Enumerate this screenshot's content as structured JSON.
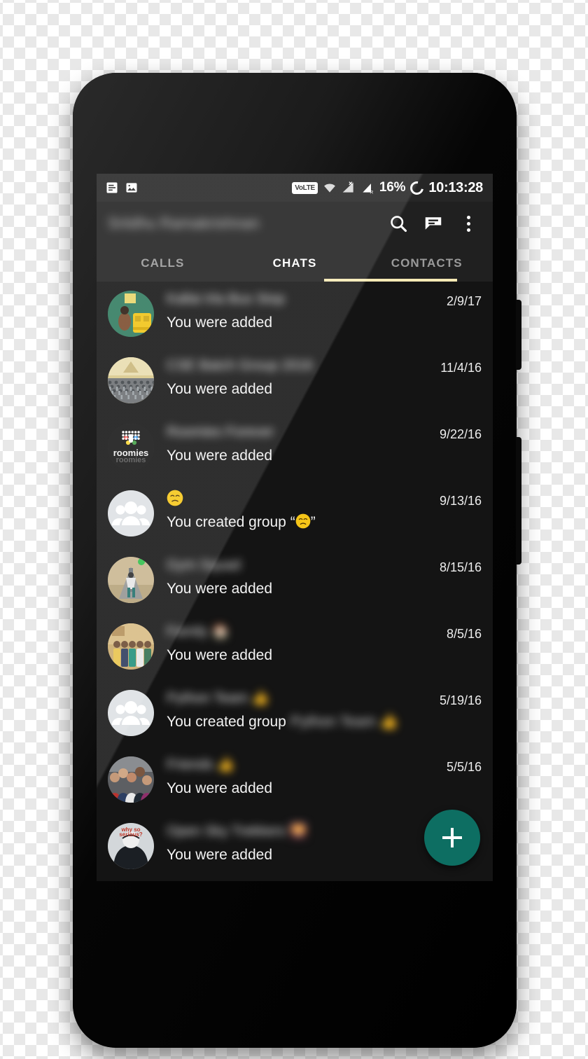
{
  "device": {
    "name": "android-phone-mockup",
    "frame_color": "#0b0b0b"
  },
  "status_bar": {
    "notification_icons": [
      "message-note-icon",
      "image-icon"
    ],
    "volte_label": "VoLTE",
    "network_icons": [
      "wifi-icon",
      "signal-no-sim-icon",
      "signal-roaming-icon"
    ],
    "battery_percent": "16%",
    "battery_icon": "battery-circle-icon",
    "clock": "10:13:28"
  },
  "app_bar": {
    "title": "Sriidhu Ramakrishnan",
    "actions": [
      {
        "name": "search-icon",
        "label": "Search"
      },
      {
        "name": "message-icon",
        "label": "New message"
      },
      {
        "name": "overflow-menu-icon",
        "label": "More options"
      }
    ]
  },
  "tabs": {
    "items": [
      {
        "label": "CALLS",
        "active": false
      },
      {
        "label": "CHATS",
        "active": true
      },
      {
        "label": "CONTACTS",
        "active": false
      }
    ],
    "indicator_color": "#f6e9b4"
  },
  "chats": [
    {
      "title": "Kallai Irla Bus Stop",
      "subtitle": "You were added",
      "date": "2/9/17",
      "avatar": "photo-bus",
      "blurred_title": true
    },
    {
      "title": "CSE Batch Group 2016",
      "subtitle": "You were added",
      "date": "11/4/16",
      "avatar": "photo-crowd",
      "blurred_title": true
    },
    {
      "title": "Roomies Forever",
      "subtitle": "You were added",
      "date": "9/22/16",
      "avatar": "logo-roomies",
      "blurred_title": true
    },
    {
      "title": "😞",
      "subtitle_prefix": "You created group “",
      "subtitle_emoji": "😞",
      "subtitle_suffix": "”",
      "subtitle": "You created group “😞”",
      "date": "9/13/16",
      "avatar": "default-group",
      "blurred_title": false,
      "title_is_emoji": true
    },
    {
      "title": "Gym Squad",
      "subtitle": "You were added",
      "date": "8/15/16",
      "avatar": "photo-gym",
      "blurred_title": true
    },
    {
      "title": "Family 🏠",
      "subtitle": "You were added",
      "date": "8/5/16",
      "avatar": "photo-family",
      "blurred_title": true
    },
    {
      "title": "Python Team 👍",
      "subtitle_prefix": "You created group ",
      "subtitle_tail": "Python Team 👍",
      "subtitle": "You created group Python Team",
      "date": "5/19/16",
      "avatar": "default-group",
      "blurred_title": true
    },
    {
      "title": "Friends 👍",
      "subtitle": "You were added",
      "date": "5/5/16",
      "avatar": "photo-selfie",
      "blurred_title": true
    },
    {
      "title": "Open Sky Trekkers 🌄",
      "subtitle": "You were added",
      "date": "",
      "avatar": "photo-joker",
      "blurred_title": true
    }
  ],
  "fab": {
    "label": "+",
    "name": "new-chat-fab",
    "color": "#0d6e62"
  }
}
